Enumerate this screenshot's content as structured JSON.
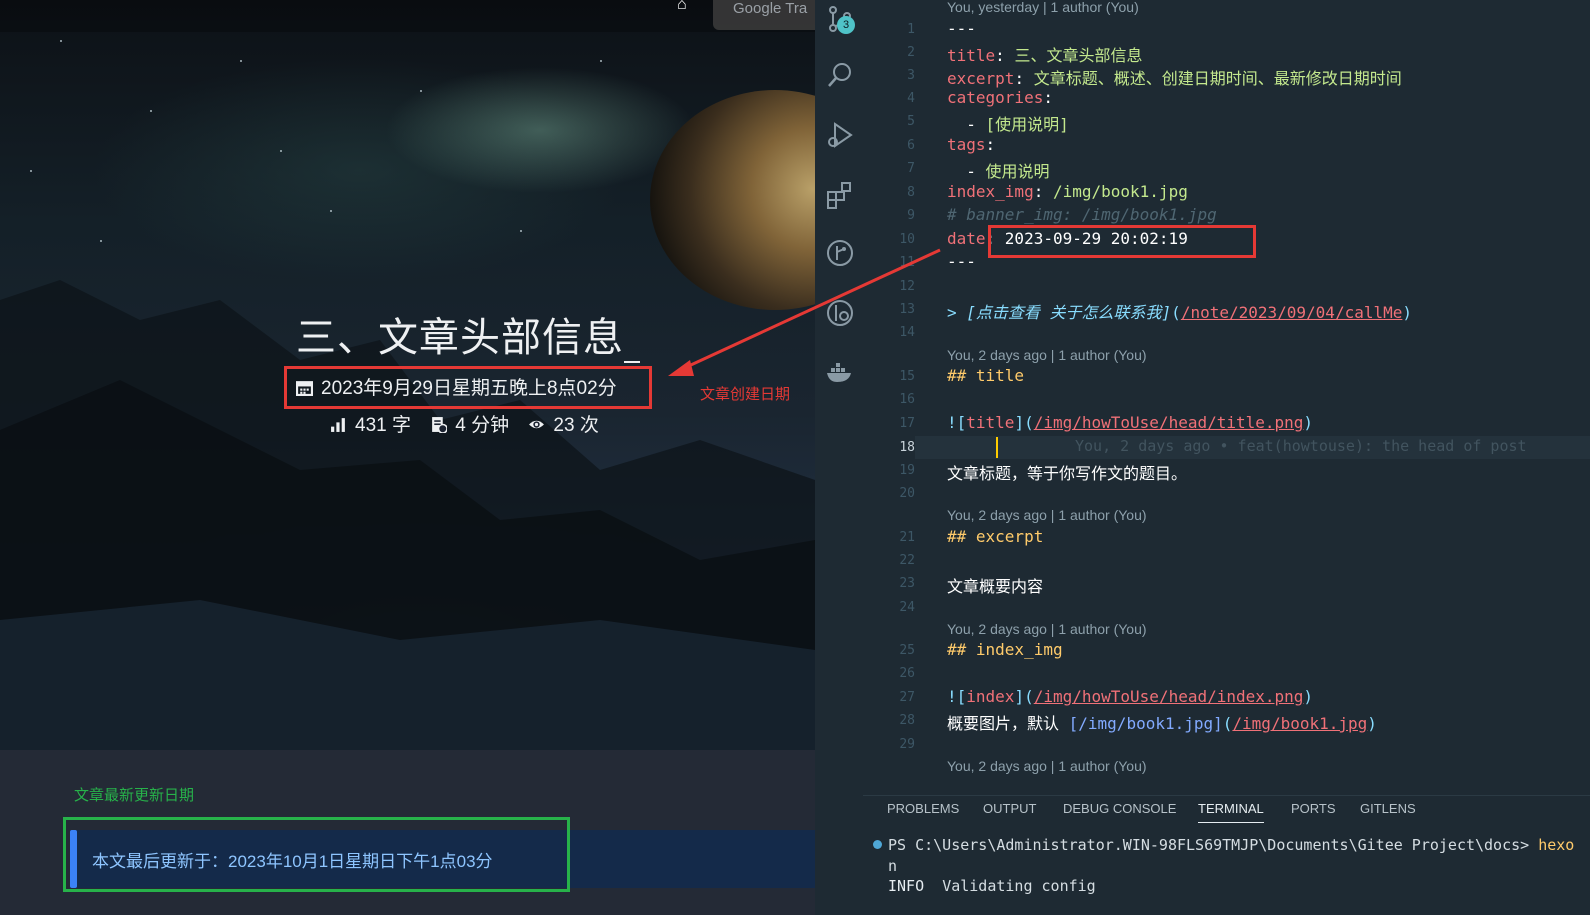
{
  "blog": {
    "top_tooltip": "Google Tra",
    "title": "三、文章头部信息",
    "created_date": "2023年9月29日星期五晚上8点02分",
    "word_count": "431 字",
    "read_time": "4 分钟",
    "views": "23 次",
    "annotation_created": "文章创建日期",
    "annotation_updated": "文章最新更新日期",
    "updated_note": "本文最后更新于：2023年10月1日星期日下午1点03分"
  },
  "colors": {
    "annotation_red": "#e53935",
    "annotation_green": "#27b24a",
    "note_text": "#8ec5ff",
    "note_accent": "#3b82f6",
    "editor_bg": "#1e2a33",
    "yaml_key": "#f07178",
    "yaml_value": "#c3e88d"
  },
  "vscode": {
    "activity_bar": {
      "icons": [
        "source-control-icon",
        "search-icon",
        "run-debug-icon",
        "extensions-icon",
        "git-graph-icon",
        "gitlens-icon",
        "docker-icon"
      ],
      "scm_badge": "3"
    },
    "blame": {
      "b0": "You, yesterday | 1 author (You)",
      "b1": "You, 2 days ago | 1 author (You)",
      "b2": "You, 2 days ago | 1 author (You)",
      "b3": "You, 2 days ago | 1 author (You)",
      "b4": "You, 2 days ago | 1 author (You)"
    },
    "line_numbers": [
      "1",
      "2",
      "3",
      "4",
      "5",
      "6",
      "7",
      "8",
      "9",
      "10",
      "11",
      "12",
      "13",
      "14",
      "15",
      "16",
      "17",
      "18",
      "19",
      "20",
      "21",
      "22",
      "23",
      "24",
      "25",
      "26",
      "27",
      "28",
      "29"
    ],
    "frontmatter": {
      "dashes": "---",
      "title_key": "title",
      "title_val": "三、文章头部信息",
      "excerpt_key": "excerpt",
      "excerpt_val": "文章标题、概述、创建日期时间、最新修改日期时间",
      "categories_key": "categories",
      "categories_item": "[使用说明]",
      "tags_key": "tags",
      "tags_item": "使用说明",
      "index_img_key": "index_img",
      "index_img_val": "/img/book1.jpg",
      "banner_comment": "# banner_img: /img/book1.jpg",
      "date_key": "date",
      "date_val": "2023-09-29 20:02:19"
    },
    "body": {
      "quote_link_text": "[点击查看 关于怎么联系我]",
      "quote_link_url": "/note/2023/09/04/callMe",
      "h_title": "## title",
      "img_title_alt": "title",
      "img_title_url": "/img/howToUse/head/title.png",
      "ghost_blame": "You, 2 days ago • feat(howtouse): the head of post",
      "title_desc": "文章标题，等于你写作文的题目。",
      "h_excerpt": "## excerpt",
      "excerpt_desc": "文章概要内容",
      "h_index_img": "## index_img",
      "img_index_alt": "index",
      "img_index_url": "/img/howToUse/head/index.png",
      "index_desc_prefix": "概要图片，默认 ",
      "index_desc_link_text": "[/img/book1.jpg]",
      "index_desc_link_url": "/img/book1.jpg"
    },
    "panel": {
      "tabs": [
        "PROBLEMS",
        "OUTPUT",
        "DEBUG CONSOLE",
        "TERMINAL",
        "PORTS",
        "GITLENS"
      ],
      "active_tab": "TERMINAL",
      "prompt": "PS C:\\Users\\Administrator.WIN-98FLS69TMJP\\Documents\\Gitee Project\\docs> ",
      "command": "hexo",
      "command_wrap": "n",
      "info_label": "INFO",
      "info_text": "Validating config"
    }
  }
}
